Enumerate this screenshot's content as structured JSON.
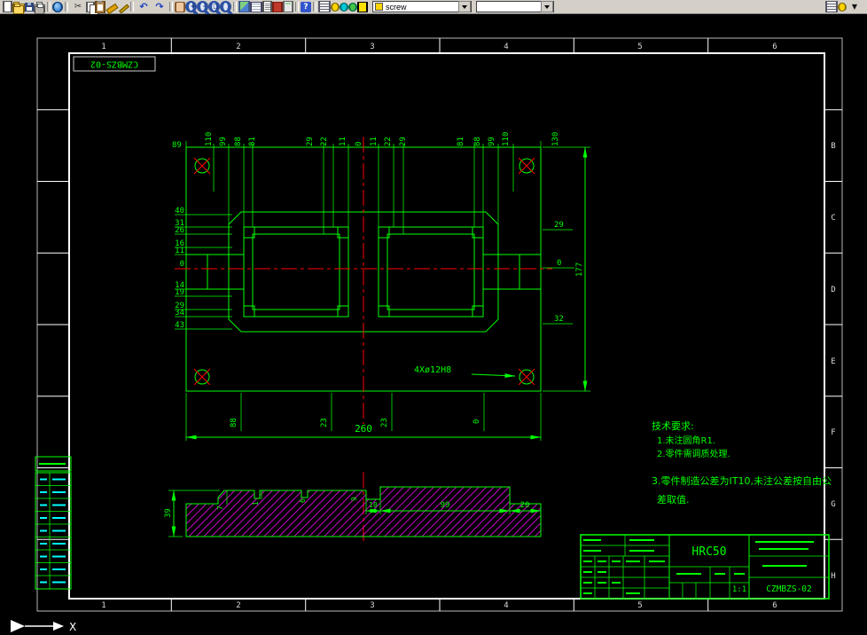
{
  "toolbar": {
    "layer_combo": {
      "value": "screw"
    },
    "color_combo": {
      "value": ""
    },
    "icons_left": [
      {
        "name": "new-file-icon",
        "cls": "i-page",
        "glyph": "",
        "inter": true
      },
      {
        "name": "open-file-icon",
        "cls": "i-folder",
        "glyph": "",
        "inter": true
      },
      {
        "name": "save-file-icon",
        "cls": "i-floppy",
        "glyph": "",
        "inter": true
      },
      {
        "name": "print-icon",
        "cls": "i-print",
        "glyph": "",
        "inter": true
      },
      {
        "name": "separator",
        "cls": "sep",
        "glyph": "",
        "inter": false
      },
      {
        "name": "web-publish-icon",
        "cls": "i-globe",
        "glyph": "",
        "inter": true
      },
      {
        "name": "separator",
        "cls": "sep",
        "glyph": "",
        "inter": false
      },
      {
        "name": "cut-icon",
        "cls": "i-glyph",
        "glyph": "✂",
        "inter": true
      },
      {
        "name": "copy-icon",
        "cls": "i-copy",
        "glyph": "",
        "inter": true
      },
      {
        "name": "paste-icon",
        "cls": "i-paste",
        "glyph": "",
        "inter": true
      },
      {
        "name": "format-painter-icon",
        "cls": "i-brush",
        "glyph": "",
        "inter": true
      },
      {
        "name": "edit-pen-icon",
        "cls": "i-pen",
        "glyph": "",
        "inter": true
      },
      {
        "name": "separator",
        "cls": "sep",
        "glyph": "",
        "inter": false
      },
      {
        "name": "undo-icon",
        "cls": "i-glyph-blue",
        "glyph": "↶",
        "inter": true
      },
      {
        "name": "redo-icon",
        "cls": "i-glyph-blue",
        "glyph": "↷",
        "inter": true
      },
      {
        "name": "separator",
        "cls": "sep",
        "glyph": "",
        "inter": false
      },
      {
        "name": "pan-icon",
        "cls": "i-hand",
        "glyph": "",
        "inter": true
      },
      {
        "name": "zoom-in-icon",
        "cls": "i-mag",
        "glyph": "+",
        "inter": true
      },
      {
        "name": "zoom-out-icon",
        "cls": "i-mag",
        "glyph": "-",
        "inter": true
      },
      {
        "name": "zoom-window-icon",
        "cls": "i-mag",
        "glyph": "□",
        "inter": true
      },
      {
        "name": "zoom-extents-icon",
        "cls": "i-mag",
        "glyph": "",
        "inter": true
      },
      {
        "name": "separator",
        "cls": "sep",
        "glyph": "",
        "inter": false
      },
      {
        "name": "design-center-icon",
        "cls": "i-dc",
        "glyph": "",
        "inter": true
      },
      {
        "name": "table-icon",
        "cls": "i-table",
        "glyph": "",
        "inter": true
      },
      {
        "name": "properties-icon",
        "cls": "i-props",
        "glyph": "",
        "inter": true
      },
      {
        "name": "markup-icon",
        "cls": "i-red",
        "glyph": "",
        "inter": true
      },
      {
        "name": "calculator-icon",
        "cls": "i-calc",
        "glyph": "",
        "inter": true
      },
      {
        "name": "separator",
        "cls": "sep",
        "glyph": "",
        "inter": false
      },
      {
        "name": "help-icon",
        "cls": "i-help",
        "glyph": "?",
        "inter": true
      },
      {
        "name": "separator",
        "cls": "sep",
        "glyph": "",
        "inter": false
      },
      {
        "name": "layer-manager-icon",
        "cls": "i-layers",
        "glyph": "",
        "inter": true
      },
      {
        "name": "layer-on-icon",
        "cls": "i-drop-y",
        "glyph": "",
        "inter": true
      },
      {
        "name": "layer-freeze-icon",
        "cls": "i-drop-c",
        "glyph": "",
        "inter": true
      },
      {
        "name": "layer-unlock-icon",
        "cls": "i-drop-g",
        "glyph": "",
        "inter": true
      },
      {
        "name": "color-swatch-icon",
        "cls": "i-swatch",
        "glyph": "",
        "inter": true
      }
    ],
    "icons_right": [
      {
        "name": "layer-states-icon",
        "cls": "i-layers",
        "glyph": "",
        "inter": true
      },
      {
        "name": "make-layer-current-icon",
        "cls": "i-drop-y",
        "glyph": "",
        "inter": true
      },
      {
        "name": "toolbar-options-icon",
        "cls": "i-arrow",
        "glyph": "▼",
        "inter": true
      }
    ]
  },
  "zones": {
    "cols": [
      "1",
      "2",
      "3",
      "4",
      "5",
      "6"
    ],
    "rows": [
      "B",
      "C",
      "D",
      "E",
      "F",
      "G",
      "H"
    ]
  },
  "drawing": {
    "part_label": "CZMBZS-02",
    "dim_top_left": "89",
    "dims_top": [
      "110",
      "99",
      "88",
      "81",
      "29",
      "22",
      "11",
      "0",
      "11",
      "22",
      "29",
      "81",
      "88",
      "99",
      "110",
      "130"
    ],
    "dims_left": [
      "40",
      "31",
      "26",
      "16",
      "11",
      "0",
      "14",
      "19",
      "29",
      "34",
      "43"
    ],
    "dims_right": [
      "29",
      "0",
      "32"
    ],
    "dim_height": "177",
    "dims_bottom": [
      "88",
      "23",
      "23",
      "0"
    ],
    "dim_width": "260",
    "hole_note": "4Xø12H8"
  },
  "tech_requirements": {
    "title": "技术要求:",
    "lines": [
      "1.未注圆角R1.",
      "2.零件需调质处理.",
      "3.零件制造公差为IT10,未注公差按自由公",
      "差取值."
    ]
  },
  "section": {
    "dims": [
      "39",
      "7",
      "1",
      "6",
      "9",
      "10",
      "99",
      "20"
    ]
  },
  "title_block": {
    "material": "HRC50",
    "scale": "1:1",
    "drawing_no": "CZMBZS-02"
  },
  "axis": {
    "label": "X"
  },
  "colors": {
    "line": "#00ff00",
    "center": "#ff0000",
    "hatch": "#ff00ff",
    "frame": "#ffffff"
  }
}
